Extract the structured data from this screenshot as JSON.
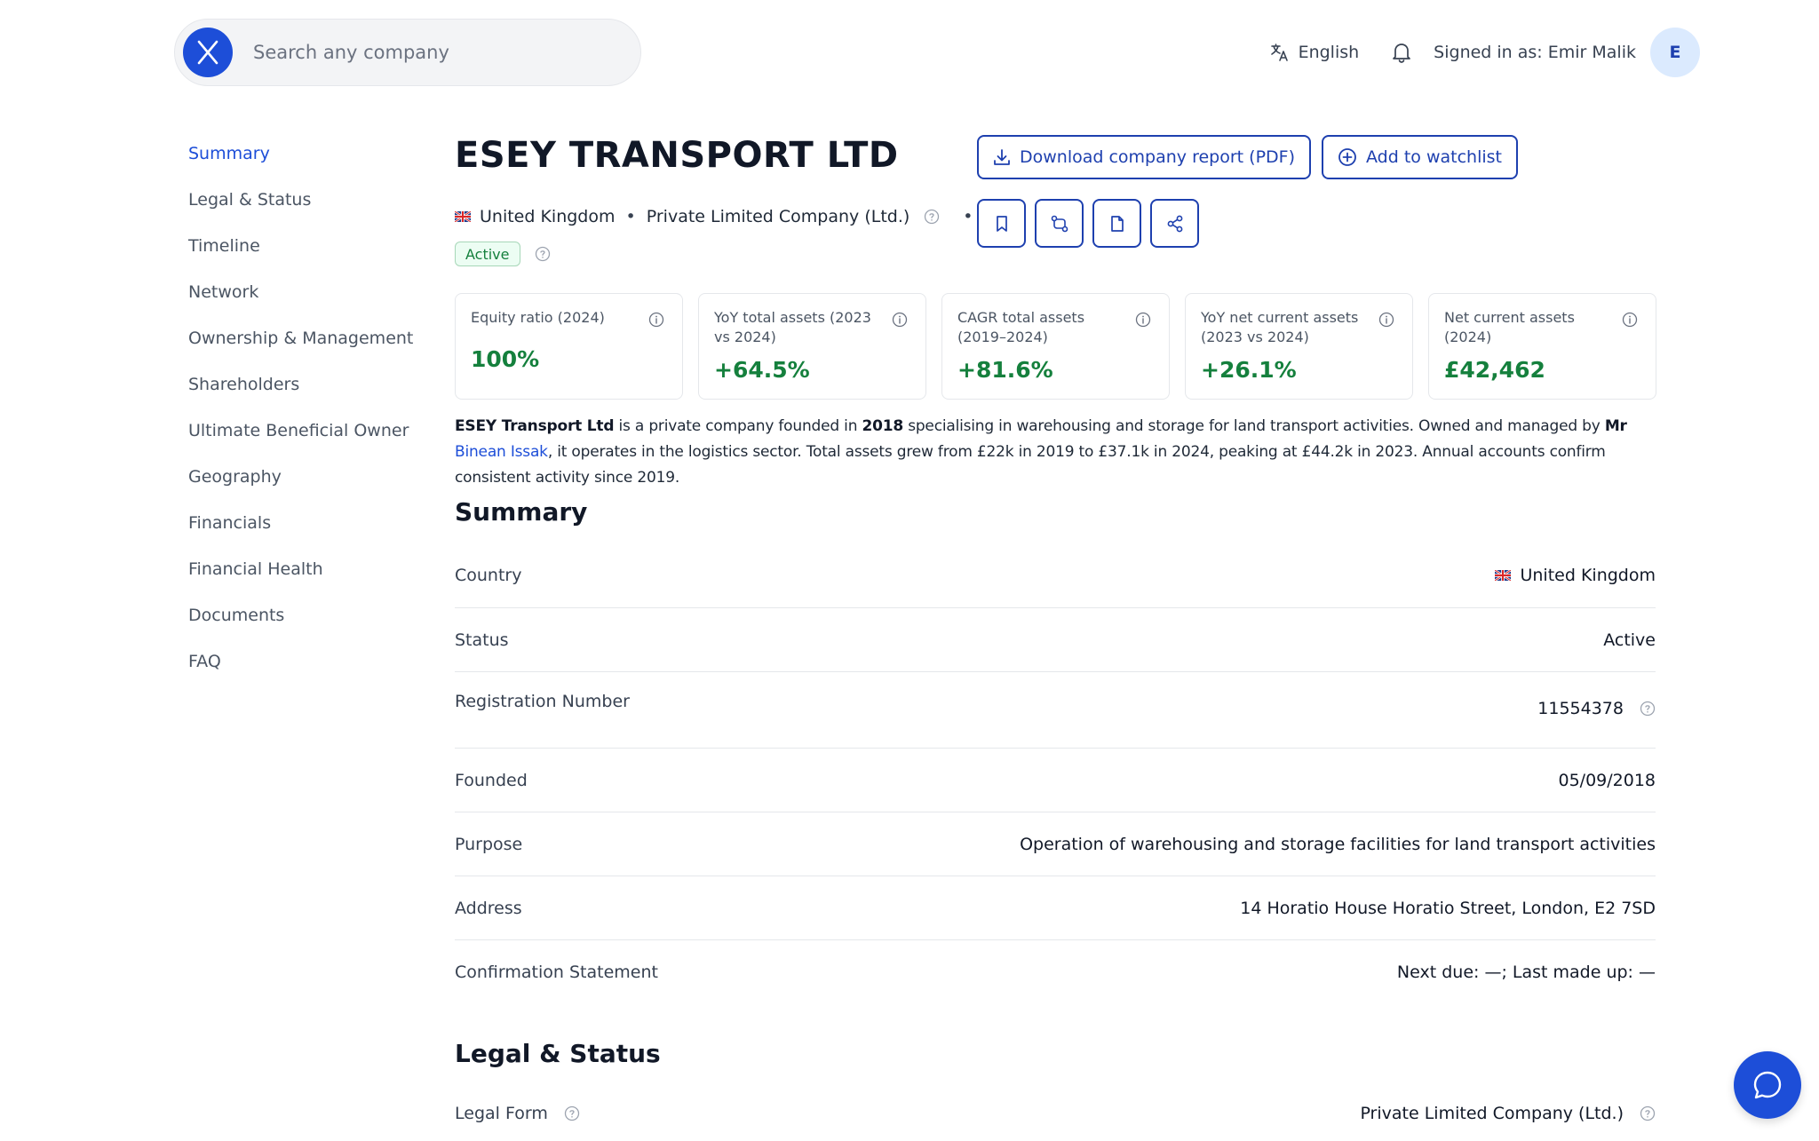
{
  "search": {
    "placeholder": "Search any company"
  },
  "header": {
    "language": "English",
    "signed_in": "Signed in as: Emir Malik",
    "avatar_initial": "E"
  },
  "sidebar": {
    "items": [
      {
        "label": "Summary",
        "active": true
      },
      {
        "label": "Legal & Status"
      },
      {
        "label": "Timeline"
      },
      {
        "label": "Network"
      },
      {
        "label": "Ownership & Management"
      },
      {
        "label": "Shareholders"
      },
      {
        "label": "Ultimate Beneficial Owner"
      },
      {
        "label": "Geography"
      },
      {
        "label": "Financials"
      },
      {
        "label": "Financial Health"
      },
      {
        "label": "Documents"
      },
      {
        "label": "FAQ"
      }
    ]
  },
  "company": {
    "name": "ESEY TRANSPORT LTD",
    "country": "United Kingdom",
    "type": "Private Limited Company (Ltd.)",
    "status": "Active"
  },
  "actions": {
    "download_label": "Download company report (PDF)",
    "watchlist_label": "Add to watchlist"
  },
  "metrics": [
    {
      "label": "Equity ratio (2024)",
      "value": "100%"
    },
    {
      "label": "YoY total assets (2023 vs 2024)",
      "value": "+64.5%"
    },
    {
      "label": "CAGR total assets (2019–2024)",
      "value": "+81.6%"
    },
    {
      "label": "YoY net current assets (2023 vs 2024)",
      "value": "+26.1%"
    },
    {
      "label": "Net current assets (2024)",
      "value": "£42,462"
    }
  ],
  "description": {
    "company_name": "ESEY Transport Ltd",
    "text1": " is a private company founded in ",
    "year": "2018",
    "text2": " specialising in warehousing and storage for land transport activities. Owned and managed by ",
    "title": "Mr",
    "person": "Binean Issak",
    "text3": ", it operates in the logistics sector. Total assets grew from £22k in 2019 to £37.1k in 2024, peaking at £44.2k in 2023. Annual accounts confirm consistent activity since 2019."
  },
  "summary": {
    "title": "Summary",
    "rows": [
      {
        "label": "Country",
        "value": "United Kingdom"
      },
      {
        "label": "Status",
        "value": "Active"
      },
      {
        "label": "Registration Number",
        "value": "11554378"
      },
      {
        "label": "Founded",
        "value": "05/09/2018"
      },
      {
        "label": "Purpose",
        "value": "Operation of warehousing and storage facilities for land transport activities"
      },
      {
        "label": "Address",
        "value": "14 Horatio House Horatio Street, London, E2 7SD"
      },
      {
        "label": "Confirmation Statement",
        "value": "Next due: —; Last made up: —"
      }
    ]
  },
  "legal": {
    "title": "Legal & Status",
    "rows": [
      {
        "label": "Legal Form",
        "value": "Private Limited Company (Ltd.)"
      }
    ]
  },
  "colors": {
    "accent": "#1d4ed8",
    "positive": "#15803d"
  }
}
